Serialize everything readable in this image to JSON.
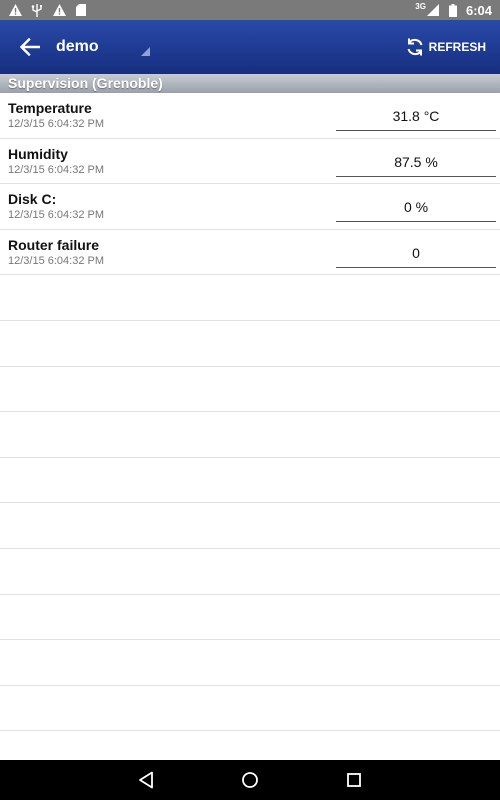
{
  "app": {
    "title": "demo",
    "refresh_label": "REFRESH"
  },
  "status_bar": {
    "time": "6:04",
    "network": "3G"
  },
  "section": {
    "title": "Supervision (Grenoble)"
  },
  "items": [
    {
      "name": "Temperature",
      "timestamp": "12/3/15 6:04:32 PM",
      "value": "31.8 °C"
    },
    {
      "name": "Humidity",
      "timestamp": "12/3/15 6:04:32 PM",
      "value": "87.5 %"
    },
    {
      "name": "Disk C:",
      "timestamp": "12/3/15 6:04:32 PM",
      "value": "0 %"
    },
    {
      "name": "Router failure",
      "timestamp": "12/3/15 6:04:32 PM",
      "value": "0"
    }
  ],
  "icons": {
    "status_left": [
      "warning-icon",
      "usb-icon",
      "warning-icon",
      "sd-card-icon"
    ],
    "status_right": [
      "signal-icon",
      "battery-icon"
    ],
    "action_bar": [
      "back-arrow-icon",
      "refresh-icon"
    ],
    "nav": [
      "nav-back-icon",
      "nav-home-icon",
      "nav-recents-icon"
    ]
  },
  "colors": {
    "action_bar": "#1d3990",
    "status_bar": "#7a7a7a",
    "section_header": "#9aa1aa"
  }
}
